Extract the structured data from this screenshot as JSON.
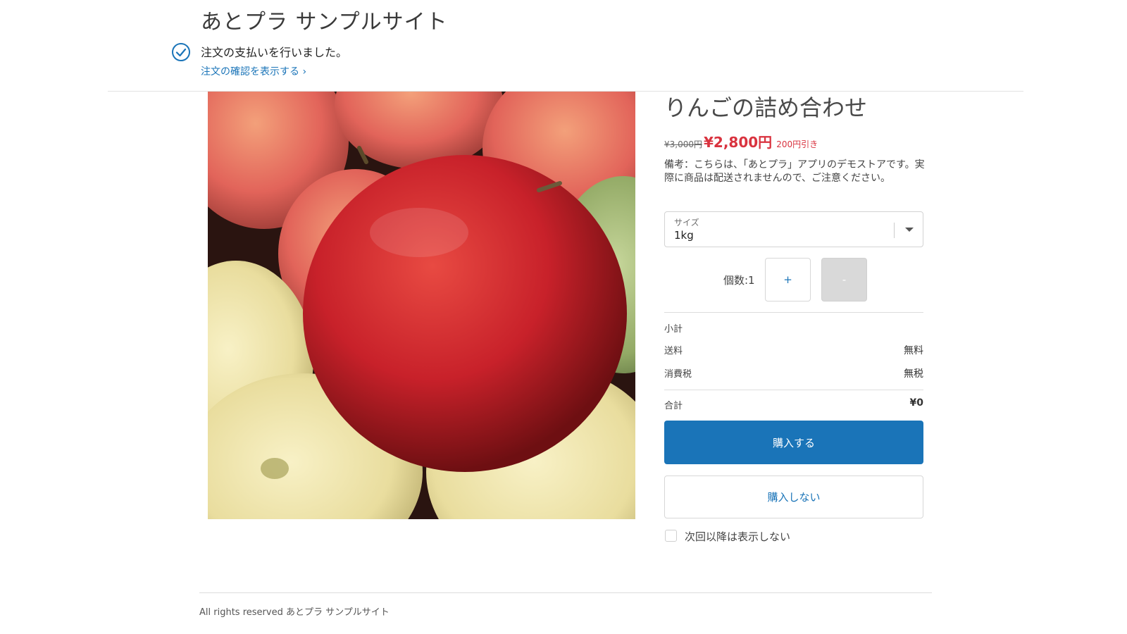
{
  "header": {
    "site_title": "あとプラ サンプルサイト",
    "status_message": "注文の支払いを行いました。",
    "order_link": "注文の確認を表示する ›"
  },
  "product": {
    "image_alt": "りんご",
    "title": "りんごの詰め合わせ",
    "price_original": "¥3,000円",
    "price_current": "¥2,800円",
    "price_discount": "200円引き",
    "note": "備考：こちらは、「あとプラ」アプリのデモストアです。実際に商品は配送されませんので、ご注意ください。"
  },
  "size_select": {
    "label": "サイズ",
    "value": "1kg"
  },
  "quantity": {
    "label": "個数:1",
    "plus_label": "+",
    "minus_label": "-"
  },
  "summary": {
    "subtotal_label": "小計",
    "shipping_label": "送料",
    "shipping_value": "無料",
    "tax_label": "消費税",
    "tax_value": "無税",
    "total_label": "合計",
    "total_value": "¥0"
  },
  "actions": {
    "buy_label": "購入する",
    "no_buy_label": "購入しない",
    "dont_show_label": "次回以降は表示しない"
  },
  "footer": {
    "text": "All rights reserved あとプラ サンプルサイト"
  },
  "colors": {
    "accent": "#1a74b8",
    "price_red": "#d9333f",
    "disabled": "#d9d9d9"
  },
  "icons": {
    "status": "check-circle-icon",
    "dropdown": "chevron-down-icon"
  }
}
